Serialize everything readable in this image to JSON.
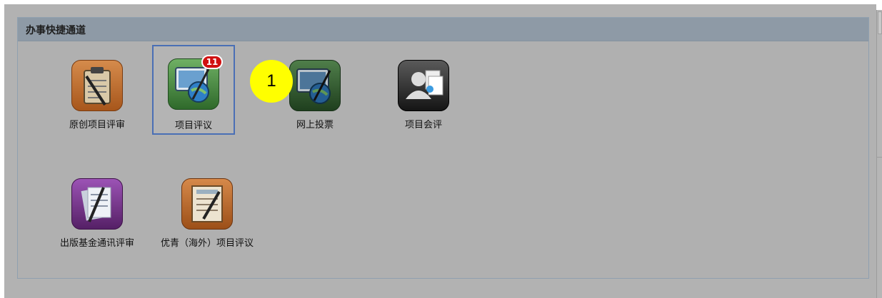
{
  "panel": {
    "title": "办事快捷通道"
  },
  "tiles": [
    {
      "label": "原创项目评审",
      "icon": "clipboard-icon"
    },
    {
      "label": "项目评议",
      "icon": "monitor-globe-icon",
      "badge": "11"
    },
    {
      "label": "网上投票",
      "icon": "monitor-globe-icon"
    },
    {
      "label": "项目会评",
      "icon": "users-documents-icon"
    },
    {
      "label": "出版基金通讯评审",
      "icon": "documents-pen-icon"
    },
    {
      "label": "优青（海外）项目评议",
      "icon": "form-pen-icon"
    }
  ],
  "step_marker": "1",
  "colors": {
    "selected_border": "#4a6fb5",
    "badge": "#d01010",
    "marker": "#ffff00"
  }
}
